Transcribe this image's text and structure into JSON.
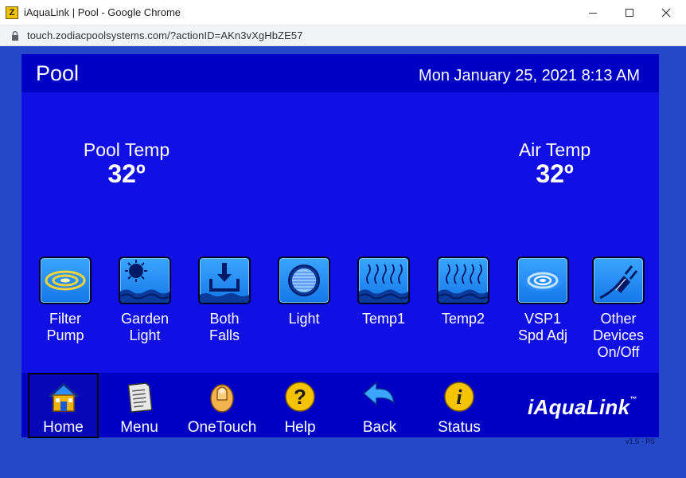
{
  "window": {
    "title": "iAquaLink | Pool - Google Chrome",
    "app_icon_letter": "Z",
    "url": "touch.zodiacpoolsystems.com/?actionID=AKn3vXgHbZE57"
  },
  "header": {
    "title": "Pool",
    "datetime": "Mon January 25, 2021 8:13 AM"
  },
  "temps": {
    "pool": {
      "label": "Pool Temp",
      "value": "32º"
    },
    "air": {
      "label": "Air Temp",
      "value": "32º"
    }
  },
  "devices": [
    {
      "label": "Filter\nPump",
      "icon": "filter-pump-icon"
    },
    {
      "label": "Garden\nLight",
      "icon": "sun-icon"
    },
    {
      "label": "Both\nFalls",
      "icon": "waterfall-icon"
    },
    {
      "label": "Light",
      "icon": "pool-light-icon"
    },
    {
      "label": "Temp1",
      "icon": "heater-icon"
    },
    {
      "label": "Temp2",
      "icon": "heater-icon"
    },
    {
      "label": "VSP1\nSpd Adj",
      "icon": "variable-speed-pump-icon"
    },
    {
      "label": "Other\nDevices\nOn/Off",
      "icon": "plug-icon"
    }
  ],
  "nav": {
    "home": "Home",
    "menu": "Menu",
    "onetouch": "OneTouch",
    "help": "Help",
    "back": "Back",
    "status": "Status"
  },
  "brand": {
    "name": "iAquaLink",
    "tm": "™"
  },
  "version": "v1.5 - PS",
  "colors": {
    "panel": "#0f0fe6",
    "header": "#0000c4",
    "page_bg": "#2448c8",
    "icon_blue": "#1577e8"
  }
}
